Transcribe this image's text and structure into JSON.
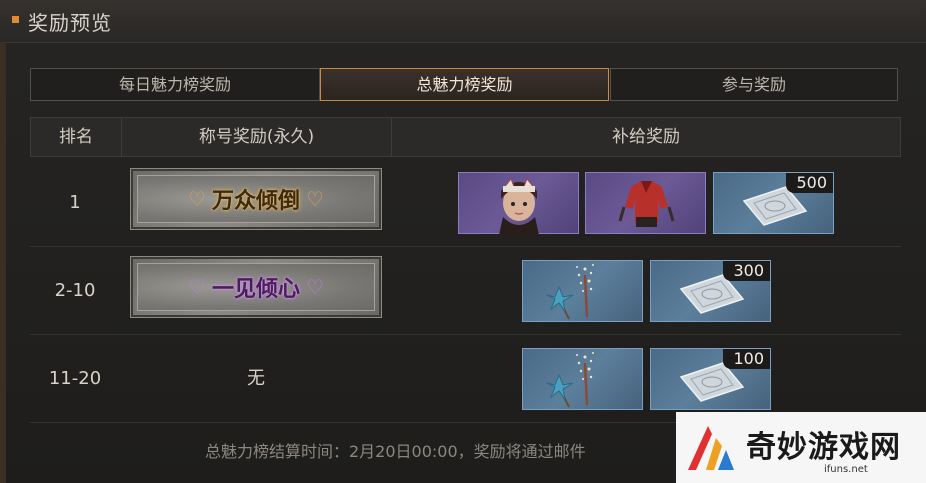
{
  "window": {
    "title": "奖励预览"
  },
  "tabs": [
    {
      "label": "每日魅力榜奖励",
      "active": false
    },
    {
      "label": "总魅力榜奖励",
      "active": true
    },
    {
      "label": "参与奖励",
      "active": false
    }
  ],
  "table": {
    "headers": {
      "rank": "排名",
      "title_reward": "称号奖励(永久)",
      "supply_reward": "补给奖励"
    },
    "rows": [
      {
        "rank": "1",
        "title": "万众倾倒",
        "title_style": "gold",
        "items": [
          {
            "icon": "character-head-icon",
            "bg": "purple",
            "qty": ""
          },
          {
            "icon": "red-jacket-outfit-icon",
            "bg": "purple",
            "qty": ""
          },
          {
            "icon": "voucher-packet-icon",
            "bg": "blue",
            "qty": "500"
          }
        ]
      },
      {
        "rank": "2-10",
        "title": "一见倾心",
        "title_style": "purple",
        "items": [
          {
            "icon": "pinwheel-sparkler-icon",
            "bg": "blue",
            "qty": ""
          },
          {
            "icon": "voucher-packet-icon",
            "bg": "blue",
            "qty": "300"
          }
        ]
      },
      {
        "rank": "11-20",
        "title": "无",
        "title_style": "none",
        "items": [
          {
            "icon": "pinwheel-sparkler-icon",
            "bg": "blue",
            "qty": ""
          },
          {
            "icon": "voucher-packet-icon",
            "bg": "blue",
            "qty": "100"
          }
        ]
      }
    ]
  },
  "footer": {
    "text": "总魅力榜结算时间：2月20日00:00，奖励将通过邮件"
  },
  "watermark": {
    "text": "奇妙游戏网",
    "url": "ifuns.net"
  },
  "colors": {
    "accent": "#e08b2e",
    "active_tab_border": "#c7894a",
    "gold_glow": "#d7a64e",
    "purple_glow": "#b77fd2"
  }
}
